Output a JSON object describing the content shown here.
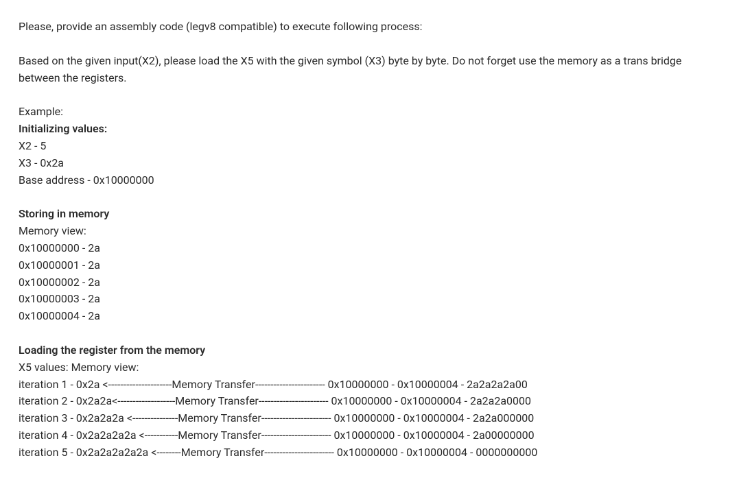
{
  "intro": "Please, provide an assembly code (legv8 compatible) to execute following process:",
  "task": "Based on the given input(X2), please load the X5 with the given symbol (X3) byte by byte. Do not forget use the memory as a trans bridge between the registers.",
  "example_label": "Example:",
  "init_heading": "Initializing values:",
  "init_lines": {
    "x2": "X2 - 5",
    "x3": "X3 - 0x2a",
    "base": "Base address - 0x10000000"
  },
  "storing_heading": "Storing in memory",
  "memory_view_label": "Memory view:",
  "memory_lines": {
    "m0": "0x10000000 - 2a",
    "m1": "0x10000001 - 2a",
    "m2": "0x10000002 - 2a",
    "m3": "0x10000003 - 2a",
    "m4": "0x10000004 - 2a"
  },
  "loading_heading": "Loading the register from the memory",
  "x5_label": "X5 values: Memory view:",
  "iterations": {
    "i1": "iteration 1 - 0x2a <---------------------Memory Transfer----------------------- 0x10000000 - 0x10000004 - 2a2a2a2a00",
    "i2": "iteration 2 - 0x2a2a<-------------------Memory Transfer----------------------- 0x10000000 - 0x10000004 - 2a2a2a0000",
    "i3": "iteration 3 - 0x2a2a2a <---------------Memory Transfer----------------------- 0x10000000 - 0x10000004 - 2a2a000000",
    "i4": "iteration 4 - 0x2a2a2a2a <-----------Memory Transfer----------------------- 0x10000000 - 0x10000004 - 2a00000000",
    "i5": "iteration 5 - 0x2a2a2a2a2a <--------Memory Transfer----------------------- 0x10000000 - 0x10000004 - 0000000000"
  }
}
